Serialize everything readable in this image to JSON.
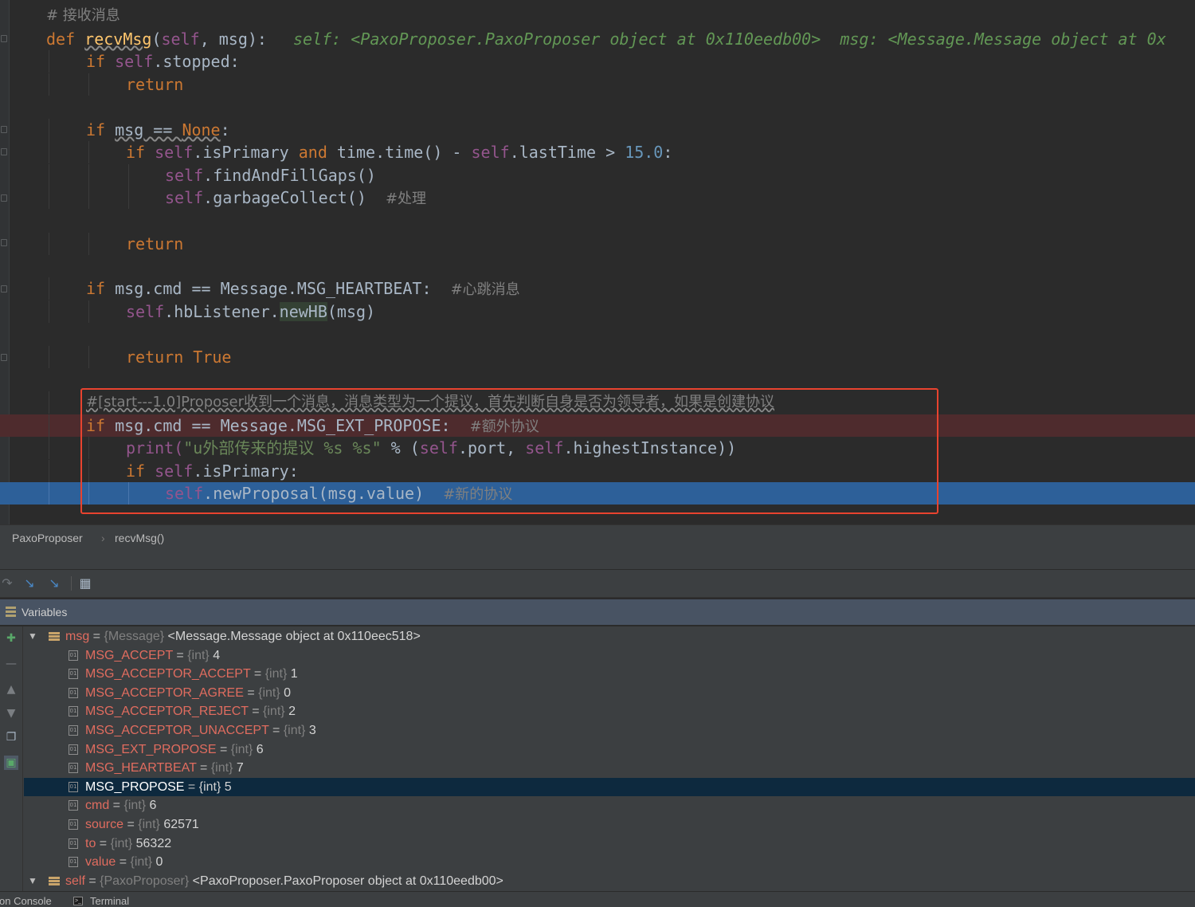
{
  "editor": {
    "comment_recv": "# 接收消息",
    "def_kw": "def",
    "func_name": "recvMsg",
    "params_self": "self",
    "params_rest": ", msg):",
    "params_open": "(",
    "inline_hint": "self: <PaxoProposer.PaxoProposer object at 0x110eedb00>  msg: <Message.Message object at 0x",
    "lines": {
      "if_stopped_kw": "if",
      "if_stopped_self": "self",
      "if_stopped_rest": ".stopped:",
      "return1": "return",
      "if_none_kw": "if",
      "if_none_msg": "msg",
      "if_none_eq": " == ",
      "if_none_val": "None",
      "if_none_colon": ":",
      "if_primary_kw": "if",
      "if_primary_self": "self",
      "if_primary_a": ".isPrimary ",
      "if_primary_and": "and",
      "if_primary_b": " time.time() - ",
      "if_primary_self2": "self",
      "if_primary_c": ".lastTime > ",
      "if_primary_num": "15.0",
      "if_primary_colon": ":",
      "find_self": "self",
      "find_rest": ".findAndFillGaps()",
      "gc_self": "self",
      "gc_rest": ".garbageCollect()  ",
      "gc_comment": "#处理",
      "return2": "return",
      "hb_kw": "if",
      "hb_rest": " msg.cmd == Message.MSG_HEARTBEAT:  ",
      "hb_comment": "#心跳消息",
      "newhb_self": "self",
      "newhb_a": ".hbListener.",
      "newhb_usage": "newHB",
      "newhb_b": "(msg)",
      "return_true_kw": "return",
      "return_true_val": " True",
      "start_comment": "#[start---1.0]Proposer收到一个消息，消息类型为一个提议，首先判断自身是否为领导者，如果是创建协议",
      "ext_kw": "if",
      "ext_rest": " msg.cmd == Message.MSG_EXT_PROPOSE:  ",
      "ext_comment": "#额外协议",
      "print_fn": "print(",
      "print_str": "\"u外部传来的提议 %s %s\"",
      "print_pct": " % (",
      "print_self": "self",
      "print_a": ".port, ",
      "print_self2": "self",
      "print_b": ".highestInstance))",
      "is_primary_kw": "if",
      "is_primary_self": "self",
      "is_primary_rest": ".isPrimary:",
      "new_prop_self": "self",
      "new_prop_rest": ".newProposal(msg.value)  ",
      "new_prop_comment": "#新的协议"
    }
  },
  "breadcrumb": {
    "class_name": "PaxoProposer",
    "separator": "›",
    "method_name": "recvMsg()"
  },
  "variables_panel": {
    "title": "Variables",
    "rows": [
      {
        "name": "msg",
        "type": "{Message}",
        "value": "<Message.Message object at 0x110eec518>",
        "kind": "object",
        "expanded": true
      },
      {
        "name": "MSG_ACCEPT",
        "type": "{int}",
        "value": "4",
        "kind": "field"
      },
      {
        "name": "MSG_ACCEPTOR_ACCEPT",
        "type": "{int}",
        "value": "1",
        "kind": "field"
      },
      {
        "name": "MSG_ACCEPTOR_AGREE",
        "type": "{int}",
        "value": "0",
        "kind": "field"
      },
      {
        "name": "MSG_ACCEPTOR_REJECT",
        "type": "{int}",
        "value": "2",
        "kind": "field"
      },
      {
        "name": "MSG_ACCEPTOR_UNACCEPT",
        "type": "{int}",
        "value": "3",
        "kind": "field"
      },
      {
        "name": "MSG_EXT_PROPOSE",
        "type": "{int}",
        "value": "6",
        "kind": "field"
      },
      {
        "name": "MSG_HEARTBEAT",
        "type": "{int}",
        "value": "7",
        "kind": "field"
      },
      {
        "name": "MSG_PROPOSE",
        "type": "{int}",
        "value": "5",
        "kind": "field",
        "selected": true
      },
      {
        "name": "cmd",
        "type": "{int}",
        "value": "6",
        "kind": "field"
      },
      {
        "name": "source",
        "type": "{int}",
        "value": "62571",
        "kind": "field"
      },
      {
        "name": "to",
        "type": "{int}",
        "value": "56322",
        "kind": "field"
      },
      {
        "name": "value",
        "type": "{int}",
        "value": "0",
        "kind": "field"
      },
      {
        "name": "self",
        "type": "{PaxoProposer}",
        "value": "<PaxoProposer.PaxoProposer object at 0x110eedb00>",
        "kind": "object",
        "expanded": true
      }
    ],
    "eq": " = "
  },
  "bottom_tabs": {
    "console_label": "on Console",
    "terminal_label": "Terminal"
  },
  "colors": {
    "editor_bg": "#2b2b2b",
    "keyword": "#cc7832",
    "self": "#94558d",
    "function": "#ffc66d",
    "number": "#6897bb",
    "string": "#6a8759",
    "comment": "#808080",
    "execution_line": "#2d6099",
    "breakpoint_line": "#4e2b2d",
    "annotation_box": "#e8432f",
    "selected_row": "#0d293e"
  },
  "icons": {
    "toolbar": [
      "step-over-icon",
      "step-into-icon",
      "step-into-my-code-icon",
      "evaluate-expression-icon"
    ],
    "side": [
      "new-watch-icon",
      "remove-watch-icon",
      "up-icon",
      "down-icon",
      "copy-icon",
      "show-values-icon"
    ]
  }
}
